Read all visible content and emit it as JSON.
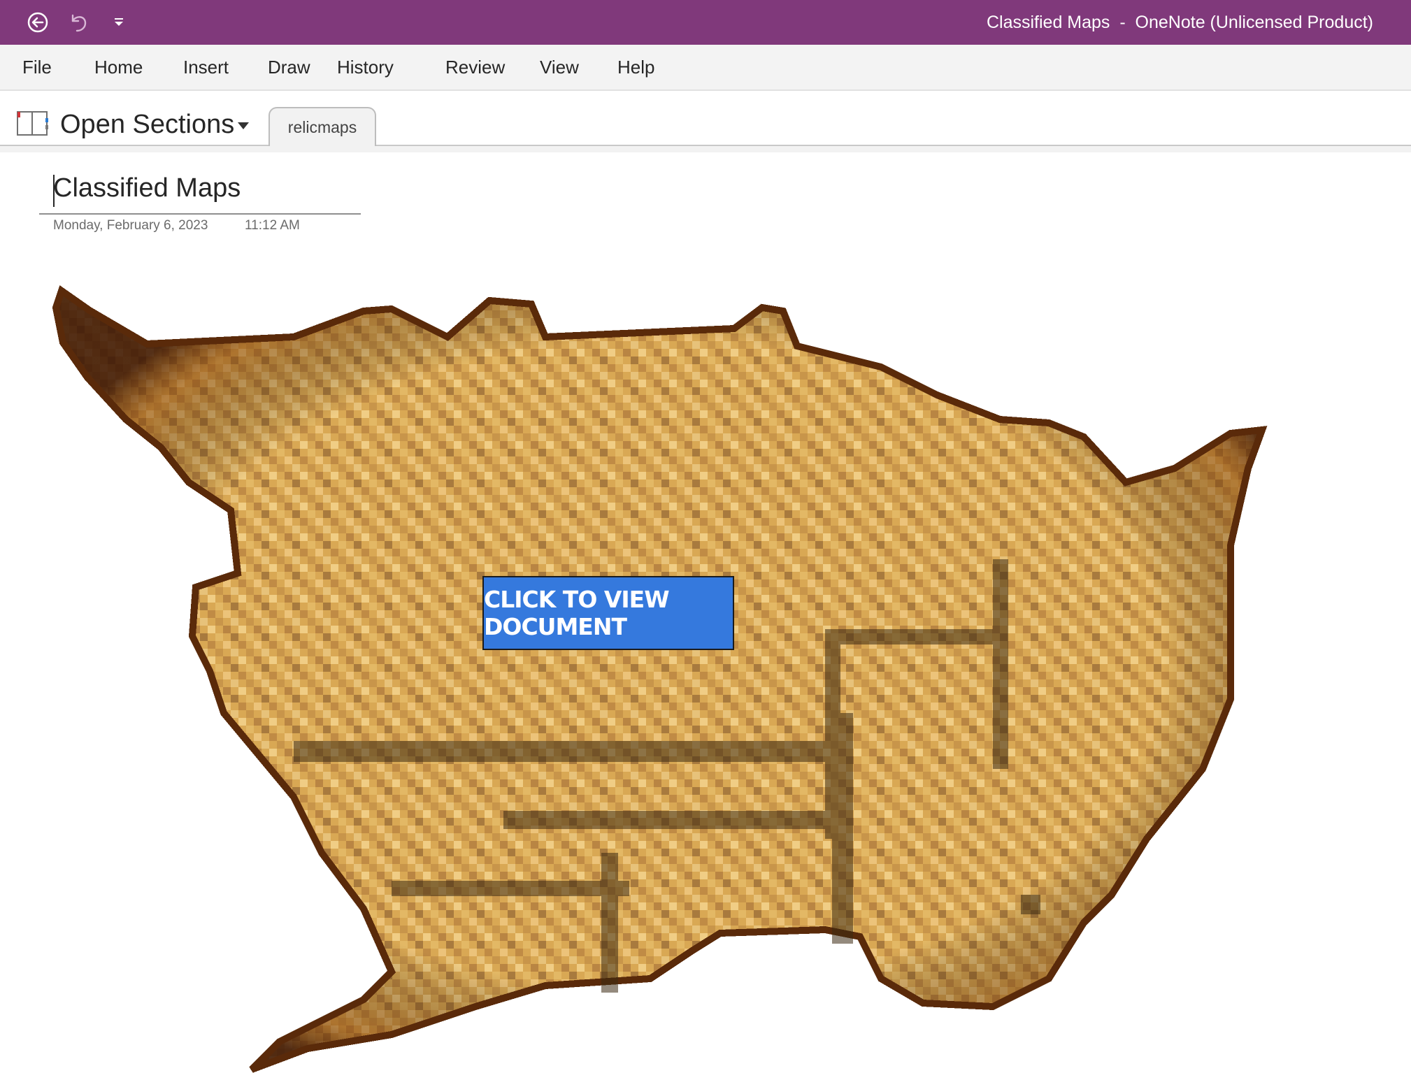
{
  "window": {
    "title": "Classified Maps  -  OneNote (Unlicensed Product)",
    "titlebar_color": "#80397b"
  },
  "quick_access": {
    "icons": [
      "back-icon",
      "undo-icon",
      "customize-quick-access-icon"
    ]
  },
  "ribbon": {
    "tabs": [
      {
        "label": "File"
      },
      {
        "label": "Home"
      },
      {
        "label": "Insert"
      },
      {
        "label": "Draw"
      },
      {
        "label": "History"
      },
      {
        "label": "Review"
      },
      {
        "label": "View"
      },
      {
        "label": "Help"
      }
    ]
  },
  "notebook": {
    "label": "Open Sections",
    "section_tab": "relicmaps"
  },
  "page": {
    "title": "Classified Maps",
    "date": "Monday, February 6, 2023",
    "time": "11:12 AM"
  },
  "embedded": {
    "image_description": "pixelated-old-map-image",
    "button_label": "CLICK TO VIEW DOCUMENT",
    "button_color": "#3579dd"
  }
}
